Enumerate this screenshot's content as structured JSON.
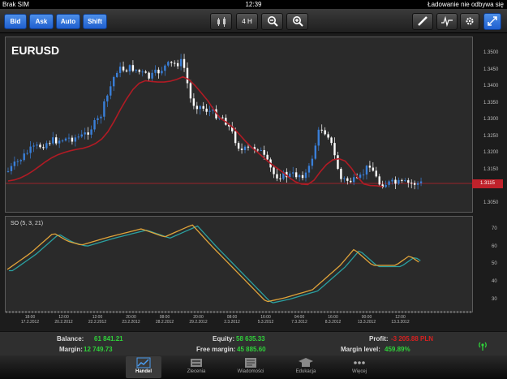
{
  "status": {
    "carrier": "Brak SIM",
    "time": "12:39",
    "message": "Ładowanie nie odbywa się"
  },
  "toolbar": {
    "bid": "Bid",
    "ask": "Ask",
    "auto": "Auto",
    "shift": "Shift",
    "timeframe": "4 H"
  },
  "chart": {
    "symbol": "EURUSD",
    "current_price": "1.3115",
    "price_ticks": [
      "1.3500",
      "1.3450",
      "1.3400",
      "1.3350",
      "1.3300",
      "1.3250",
      "1.3200",
      "1.3150",
      "1.3100",
      "1.3050"
    ],
    "osc_label": "SO (5, 3, 21)",
    "osc_ticks": [
      "70",
      "60",
      "50",
      "40",
      "30"
    ],
    "x_labels": [
      {
        "t": "18:00",
        "d": "17.2.2012"
      },
      {
        "t": "12:00",
        "d": "20.2.2012"
      },
      {
        "t": "12:00",
        "d": "22.2.2012"
      },
      {
        "t": "20:00",
        "d": "23.2.2012"
      },
      {
        "t": "08:00",
        "d": "28.2.2012"
      },
      {
        "t": "20:00",
        "d": "29.2.2012"
      },
      {
        "t": "08:00",
        "d": "2.3.2012"
      },
      {
        "t": "16:00",
        "d": "5.3.2012"
      },
      {
        "t": "04:00",
        "d": "7.3.2012"
      },
      {
        "t": "16:00",
        "d": "8.3.2012"
      },
      {
        "t": "00:00",
        "d": "13.3.2012"
      },
      {
        "t": "12:00",
        "d": "13.3.2012"
      }
    ],
    "colors": {
      "up": "#3a7fd8",
      "down": "#ffffff",
      "ma": "#b01b24",
      "price_line": "#c0222b",
      "osc_k": "#e0a33a",
      "osc_d": "#2aa0a0"
    }
  },
  "info": {
    "balance_label": "Balance:",
    "balance": "61 841.21",
    "equity_label": "Equity:",
    "equity": "58 635.33",
    "profit_label": "Profit:",
    "profit": "-3 205.88 PLN",
    "margin_label": "Margin:",
    "margin": "12 749.73",
    "free_margin_label": "Free margin:",
    "free_margin": "45 885.60",
    "margin_level_label": "Margin level:",
    "margin_level": "459.89%"
  },
  "tabs": [
    {
      "label": "Handel",
      "icon": "chart-icon"
    },
    {
      "label": "Zlecenia",
      "icon": "orders-icon"
    },
    {
      "label": "Wiadomości",
      "icon": "news-icon"
    },
    {
      "label": "Edukacja",
      "icon": "education-icon"
    },
    {
      "label": "Więcej",
      "icon": "more-icon"
    }
  ]
}
